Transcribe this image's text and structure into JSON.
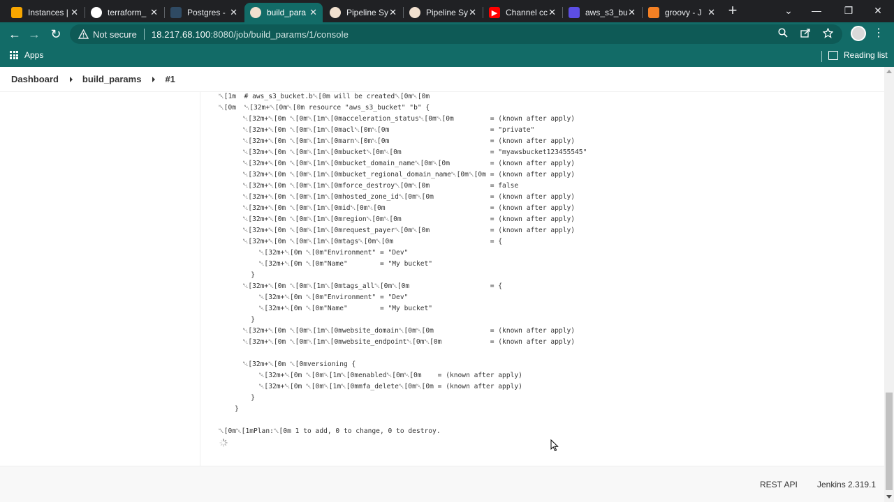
{
  "browser": {
    "tabs": [
      {
        "label": "Instances |",
        "icon": "aws-instances-icon",
        "active": false
      },
      {
        "label": "terraform_",
        "icon": "github-icon",
        "active": false
      },
      {
        "label": "Postgres -",
        "icon": "postgres-icon",
        "active": false
      },
      {
        "label": "build_para",
        "icon": "jenkins-icon",
        "active": true
      },
      {
        "label": "Pipeline Sy",
        "icon": "jenkins-icon",
        "active": false
      },
      {
        "label": "Pipeline Sy",
        "icon": "jenkins-icon",
        "active": false
      },
      {
        "label": "Channel cc",
        "icon": "youtube-icon",
        "active": false
      },
      {
        "label": "aws_s3_bu",
        "icon": "terraform-icon",
        "active": false
      },
      {
        "label": "groovy - J",
        "icon": "stackoverflow-icon",
        "active": false
      }
    ],
    "security_label": "Not secure",
    "url_host": "18.217.68.100",
    "url_rest": ":8080/job/build_params/1/console",
    "bookmarks": {
      "apps_label": "Apps",
      "reading_list_label": "Reading list"
    }
  },
  "jenkins": {
    "breadcrumb": [
      "Dashboard",
      "build_params",
      "#1"
    ],
    "console_lines": [
      "␀[1m  # aws_s3_bucket.b␀[0m will be created␀[0m␀[0m",
      "␀[0m  ␀[32m+␀[0m␀[0m resource \"aws_s3_bucket\" \"b\" {",
      "      ␀[32m+␀[0m ␀[0m␀[1m␀[0macceleration_status␀[0m␀[0m         = (known after apply)",
      "      ␀[32m+␀[0m ␀[0m␀[1m␀[0macl␀[0m␀[0m                         = \"private\"",
      "      ␀[32m+␀[0m ␀[0m␀[1m␀[0marn␀[0m␀[0m                         = (known after apply)",
      "      ␀[32m+␀[0m ␀[0m␀[1m␀[0mbucket␀[0m␀[0m                      = \"myawsbucket123455545\"",
      "      ␀[32m+␀[0m ␀[0m␀[1m␀[0mbucket_domain_name␀[0m␀[0m          = (known after apply)",
      "      ␀[32m+␀[0m ␀[0m␀[1m␀[0mbucket_regional_domain_name␀[0m␀[0m = (known after apply)",
      "      ␀[32m+␀[0m ␀[0m␀[1m␀[0mforce_destroy␀[0m␀[0m               = false",
      "      ␀[32m+␀[0m ␀[0m␀[1m␀[0mhosted_zone_id␀[0m␀[0m              = (known after apply)",
      "      ␀[32m+␀[0m ␀[0m␀[1m␀[0mid␀[0m␀[0m                          = (known after apply)",
      "      ␀[32m+␀[0m ␀[0m␀[1m␀[0mregion␀[0m␀[0m                      = (known after apply)",
      "      ␀[32m+␀[0m ␀[0m␀[1m␀[0mrequest_payer␀[0m␀[0m               = (known after apply)",
      "      ␀[32m+␀[0m ␀[0m␀[1m␀[0mtags␀[0m␀[0m                        = {",
      "          ␀[32m+␀[0m ␀[0m\"Environment\" = \"Dev\"",
      "          ␀[32m+␀[0m ␀[0m\"Name\"        = \"My bucket\"",
      "        }",
      "      ␀[32m+␀[0m ␀[0m␀[1m␀[0mtags_all␀[0m␀[0m                    = {",
      "          ␀[32m+␀[0m ␀[0m\"Environment\" = \"Dev\"",
      "          ␀[32m+␀[0m ␀[0m\"Name\"        = \"My bucket\"",
      "        }",
      "      ␀[32m+␀[0m ␀[0m␀[1m␀[0mwebsite_domain␀[0m␀[0m              = (known after apply)",
      "      ␀[32m+␀[0m ␀[0m␀[1m␀[0mwebsite_endpoint␀[0m␀[0m            = (known after apply)",
      "",
      "      ␀[32m+␀[0m ␀[0mversioning {",
      "          ␀[32m+␀[0m ␀[0m␀[1m␀[0menabled␀[0m␀[0m    = (known after apply)",
      "          ␀[32m+␀[0m ␀[0m␀[1m␀[0mmfa_delete␀[0m␀[0m = (known after apply)",
      "        }",
      "    }",
      "",
      "␀[0m␀[1mPlan:␀[0m 1 to add, 0 to change, 0 to destroy."
    ],
    "footer": {
      "rest_api": "REST API",
      "version": "Jenkins 2.319.1"
    }
  },
  "colors": {
    "browser_accent": "#126b67",
    "tab_strip": "#202124"
  }
}
